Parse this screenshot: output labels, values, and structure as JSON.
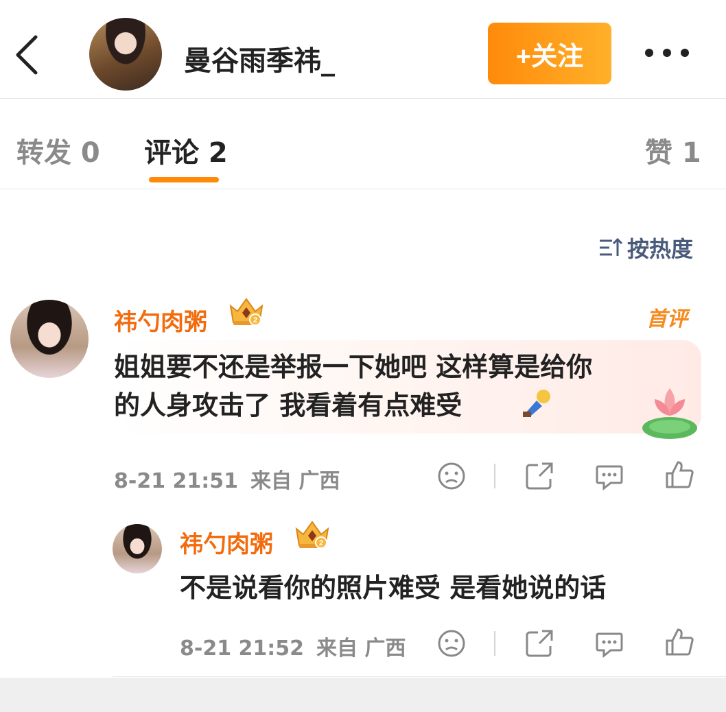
{
  "header": {
    "title": "曼谷雨季祎_",
    "follow_label": "+关注"
  },
  "tabs": [
    {
      "label": "转发 0",
      "active": false
    },
    {
      "label": "评论 2",
      "active": true
    },
    {
      "label": "赞 1",
      "active": false
    }
  ],
  "sort": {
    "label": "按热度"
  },
  "comments": [
    {
      "username": "祎勺肉粥",
      "badge": "首评",
      "text_line1": "姐姐要不还是举报一下她吧 这样算是给你",
      "text_line2": "的人身攻击了 我看着有点难受",
      "date": "8-21 21:51",
      "location": "来自 广西"
    },
    {
      "username": "祎勺肉粥",
      "text": "不是说看你的照片难受 是看她说的话",
      "date": "8-21 21:52",
      "location": "来自 广西"
    }
  ],
  "colors": {
    "accent_orange": "#ff8a0a",
    "username_orange": "#f26b0c",
    "sort_blue": "#4a5a7a"
  }
}
